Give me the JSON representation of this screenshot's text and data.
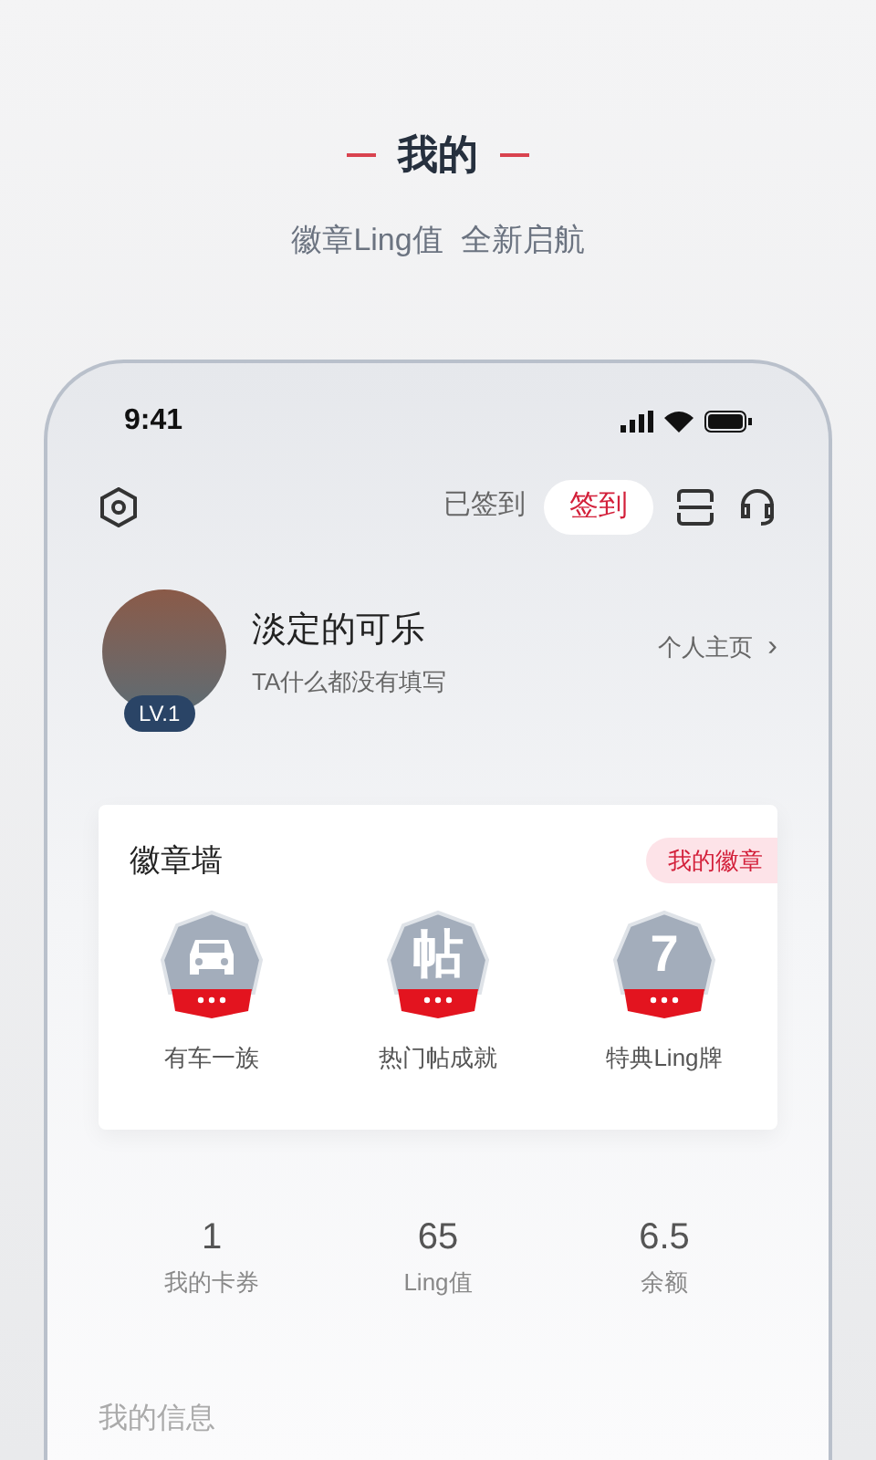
{
  "headline": {
    "title": "我的",
    "subtitle": "徽章Ling值  全新启航"
  },
  "status_bar": {
    "time": "9:41"
  },
  "toolbar": {
    "signed_text": "已签到",
    "sign_button": "签到"
  },
  "profile": {
    "name": "淡定的可乐",
    "bio": "TA什么都没有填写",
    "level": "LV.1",
    "homepage_link": "个人主页",
    "chevron": "›"
  },
  "badge_wall": {
    "title": "徽章墙",
    "my_badges_button": "我的徽章",
    "badges": [
      {
        "kind": "car",
        "label": "有车一族"
      },
      {
        "kind": "glyph",
        "glyph": "帖",
        "label": "热门帖成就"
      },
      {
        "kind": "glyph",
        "glyph": "7",
        "label": "特典Ling牌"
      }
    ]
  },
  "stats": [
    {
      "value": "1",
      "label": "我的卡券"
    },
    {
      "value": "65",
      "label": "Ling值"
    },
    {
      "value": "6.5",
      "label": "余额"
    }
  ],
  "section_title": "我的信息"
}
